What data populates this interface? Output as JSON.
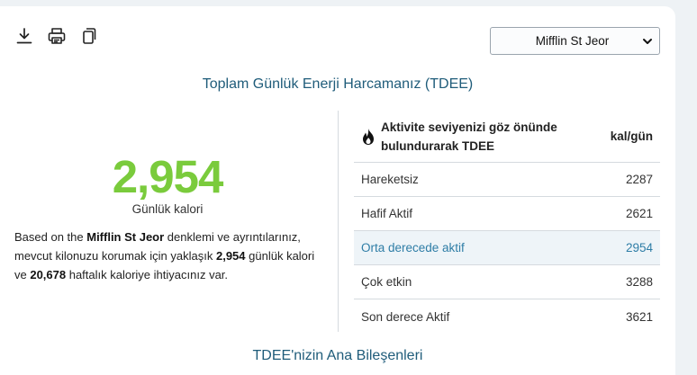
{
  "toolbar": {
    "icons": [
      "download-icon",
      "print-icon",
      "copy-icon"
    ]
  },
  "formula": {
    "selected": "Mifflin St Jeor"
  },
  "title": "Toplam Günlük Enerji Harcamanız (TDEE)",
  "summary": {
    "value": "2,954",
    "unit_label": "Günlük kalori",
    "desc_prefix": "Based on the ",
    "formula_name": "Mifflin St Jeor",
    "desc_middle": " denklemi ve ayrıntılarınız, mevcut kilonuzu korumak için yaklaşık ",
    "daily": "2,954",
    "desc_middle2": " günlük kalori ve ",
    "weekly": "20,678",
    "desc_suffix": " haftalık kaloriye ihtiyacınız var."
  },
  "table": {
    "header_label": "Aktivite seviyenizi göz önünde bulundurarak TDEE",
    "header_unit": "kal/gün",
    "rows": [
      {
        "label": "Hareketsiz",
        "value": "2287"
      },
      {
        "label": "Hafif Aktif",
        "value": "2621"
      },
      {
        "label": "Orta derecede aktif",
        "value": "2954"
      },
      {
        "label": "Çok etkin",
        "value": "3288"
      },
      {
        "label": "Son derece Aktif",
        "value": "3621"
      }
    ],
    "active_row": "Orta derecede aktif"
  },
  "colors": {
    "accent_green": "#7acb3c",
    "heading_blue": "#1f5c7a",
    "active_blue": "#2e7da6"
  },
  "subtitle": "TDEE'nizin Ana Bileşenleri"
}
